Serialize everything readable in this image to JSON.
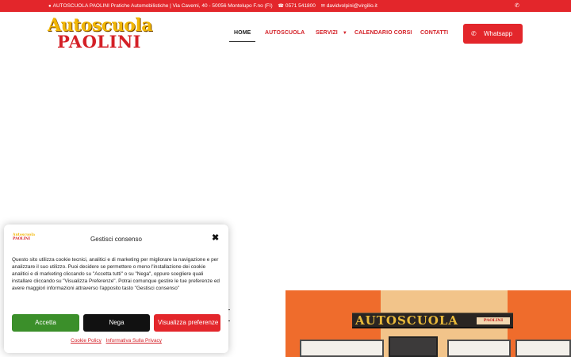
{
  "topbar": {
    "address": "AUTOSCUOLA PAOLINI Pratiche Automobilistiche | Via Cavemi, 40 - 50056 Montelupo F.no (FI)",
    "phone": "0571 541800",
    "email": "davidvolpini@virgilio.it",
    "icons": {
      "pin": "map-pin-icon",
      "phone": "phone-icon",
      "mail": "envelope-icon",
      "whatsapp": "whatsapp-icon"
    }
  },
  "header": {
    "logo": {
      "line1": "Autoscuola",
      "line2": "PAOLINI"
    },
    "nav": [
      {
        "label": "HOME",
        "active": true
      },
      {
        "label": "AUTOSCUOLA"
      },
      {
        "label": "SERVIZI",
        "has_dropdown": true
      },
      {
        "label": "CALENDARIO CORSI"
      },
      {
        "label": "CONTATTI"
      }
    ],
    "whatsapp_button": "Whatsapp"
  },
  "hero_photo": {
    "sign_text": "AUTOSCUOLA",
    "sign_subtext": "PAOLINI"
  },
  "cookie_banner": {
    "logo": {
      "line1": "Autoscuola",
      "line2": "PAOLINI"
    },
    "title": "Gestisci consenso",
    "body": "Questo sito utilizza cookie tecnici, analitici e di marketing per migliorare la navigazione e per analizzare il suo utilizzo. Puoi decidere se permettere o meno l'installazione dei cookie analitici e di marketing cliccando su \"Accetta tutti\" o su \"Nega\", oppure scegliere quali installare cliccando su \"Visualizza Preferenze\". Potrai comunque gestire le tue preferenze ed avere maggiori informazioni attraverso l'apposito tasto \"Gestisci consenso\"",
    "buttons": {
      "accept": "Accetta",
      "deny": "Nega",
      "preferences": "Visualizza preferenze"
    },
    "links": {
      "cookie_policy": "Cookie Policy",
      "privacy": "Informativa Sulla Privacy"
    },
    "colors": {
      "accept": "#3b8f2a",
      "deny": "#111111",
      "preferences": "#e3262b"
    }
  },
  "colors": {
    "brand_red": "#e3262b",
    "logo_yellow": "#f2b705"
  }
}
